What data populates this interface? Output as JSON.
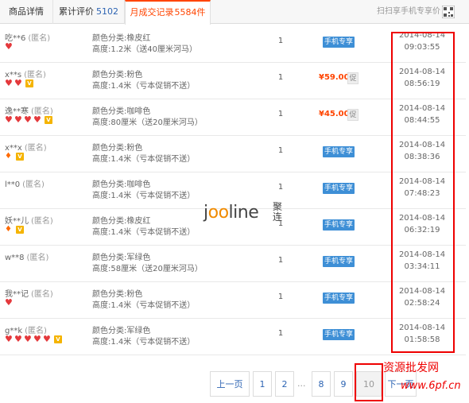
{
  "tabs": {
    "detail": "商品详情",
    "reviews_label": "累计评价",
    "reviews_count": "5102",
    "records_label": "月成交记录",
    "records_count": "5584件"
  },
  "scan_text": "扫扫享手机专享价",
  "records": [
    {
      "buyer": "吃**6",
      "anon": "(匿名)",
      "hearts": 1,
      "gems": 0,
      "vip": false,
      "attr1": "颜色分类:橡皮红",
      "attr2": "高度:1.2米（送40厘米河马）",
      "qty": "1",
      "price_type": "mobile",
      "mobile_label": "手机专享",
      "date": "2014-08-14",
      "time": "09:03:55"
    },
    {
      "buyer": "x**s",
      "anon": "(匿名)",
      "hearts": 2,
      "gems": 0,
      "vip": true,
      "attr1": "颜色分类:粉色",
      "attr2": "高度:1.4米（亏本促销不送）",
      "qty": "1",
      "price_type": "price",
      "price": "¥59.00",
      "promo": "促",
      "date": "2014-08-14",
      "time": "08:56:19"
    },
    {
      "buyer": "逸**寒",
      "anon": "(匿名)",
      "hearts": 4,
      "gems": 0,
      "vip": true,
      "attr1": "颜色分类:咖啡色",
      "attr2": "高度:80厘米（送20厘米河马）",
      "qty": "1",
      "price_type": "price",
      "price": "¥45.00",
      "promo": "促",
      "date": "2014-08-14",
      "time": "08:44:55"
    },
    {
      "buyer": "x**x",
      "anon": "(匿名)",
      "hearts": 0,
      "gems": 1,
      "vip": true,
      "attr1": "颜色分类:粉色",
      "attr2": "高度:1.4米（亏本促销不送）",
      "qty": "1",
      "price_type": "mobile",
      "mobile_label": "手机专享",
      "date": "2014-08-14",
      "time": "08:38:36"
    },
    {
      "buyer": "l**0",
      "anon": "(匿名)",
      "hearts": 0,
      "gems": 0,
      "vip": false,
      "attr1": "颜色分类:咖啡色",
      "attr2": "高度:1.4米（亏本促销不送）",
      "qty": "1",
      "price_type": "mobile",
      "mobile_label": "手机专享",
      "date": "2014-08-14",
      "time": "07:48:23"
    },
    {
      "buyer": "妖**儿",
      "anon": "(匿名)",
      "hearts": 0,
      "gems": 1,
      "vip": true,
      "attr1": "颜色分类:橡皮红",
      "attr2": "高度:1.4米（亏本促销不送）",
      "qty": "1",
      "price_type": "mobile",
      "mobile_label": "手机专享",
      "date": "2014-08-14",
      "time": "06:32:19"
    },
    {
      "buyer": "w**8",
      "anon": "(匿名)",
      "hearts": 0,
      "gems": 0,
      "vip": false,
      "attr1": "颜色分类:军绿色",
      "attr2": "高度:58厘米（送20厘米河马）",
      "qty": "1",
      "price_type": "mobile",
      "mobile_label": "手机专享",
      "date": "2014-08-14",
      "time": "03:34:11"
    },
    {
      "buyer": "我**记",
      "anon": "(匿名)",
      "hearts": 1,
      "gems": 0,
      "vip": false,
      "attr1": "颜色分类:粉色",
      "attr2": "高度:1.4米（亏本促销不送）",
      "qty": "1",
      "price_type": "mobile",
      "mobile_label": "手机专享",
      "date": "2014-08-14",
      "time": "02:58:24"
    },
    {
      "buyer": "g**k",
      "anon": "(匿名)",
      "hearts": 5,
      "gems": 0,
      "vip": true,
      "attr1": "颜色分类:军绿色",
      "attr2": "高度:1.4米（亏本促销不送）",
      "qty": "1",
      "price_type": "mobile",
      "mobile_label": "手机专享",
      "date": "2014-08-14",
      "time": "01:58:58"
    }
  ],
  "watermark": {
    "brand": "jooline",
    "brand_cn": "聚连"
  },
  "pagination": {
    "prev": "上一页",
    "pages": [
      "1",
      "2",
      "8",
      "9",
      "10"
    ],
    "dots": "...",
    "current": "10",
    "next": "下一页"
  },
  "stamp": {
    "line1": "资源批发网",
    "line2": "www.6pf.cn"
  },
  "colors": {
    "accent": "#ff4400",
    "link": "#2d64b3",
    "mobile_badge": "#3e8fd6",
    "highlight_box": "#ee0000"
  }
}
